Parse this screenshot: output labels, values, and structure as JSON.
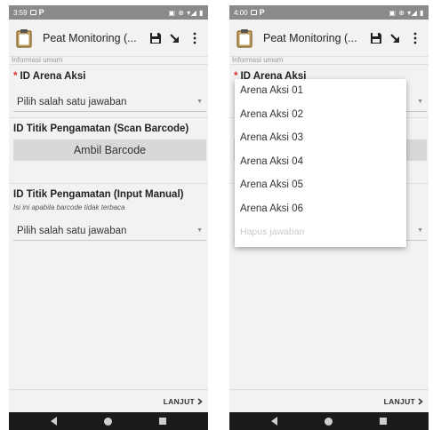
{
  "left_screen": {
    "status": {
      "time": "3:59",
      "icons": "▣ ⊕ ▾◢ ▮"
    },
    "toolbar": {
      "title": "Peat Monitoring (..."
    },
    "section_label": "Informasi umum",
    "q1": {
      "required_mark": "*",
      "title": "ID Arena Aksi",
      "value": "Pilih salah satu jawaban"
    },
    "q2": {
      "title": "ID Titik Pengamatan (Scan Barcode)",
      "button_label": "Ambil Barcode"
    },
    "q3": {
      "title": "ID Titik Pengamatan (Input Manual)",
      "hint": "Isi ini apabila barcode tidak terbaca",
      "value": "Pilih salah satu jawaban"
    },
    "next_label": "LANJUT"
  },
  "right_screen": {
    "status": {
      "time": "4:00",
      "icons": "▣ ⊕ ▾◢ ▮"
    },
    "toolbar": {
      "title": "Peat Monitoring (..."
    },
    "section_label": "Informasi umum",
    "q1": {
      "required_mark": "*",
      "title": "ID Arena Aksi"
    },
    "dropdown": {
      "options": [
        "Arena Aksi 01",
        "Arena Aksi 02",
        "Arena Aksi 03",
        "Arena Aksi 04",
        "Arena Aksi 05",
        "Arena Aksi 06"
      ],
      "clear_label": "Hapus jawaban"
    },
    "next_label": "LANJUT"
  },
  "colors": {
    "required": "#d9302c",
    "statusbar": "#8a8a8a",
    "navbar": "#1b1b1b",
    "button_bg": "#d8d8d8"
  },
  "icons": [
    "clipboard-icon",
    "save-icon",
    "goto-icon",
    "more-vert-icon",
    "chevron-right-icon",
    "caret-down-icon",
    "back-icon",
    "home-icon",
    "recents-icon"
  ]
}
